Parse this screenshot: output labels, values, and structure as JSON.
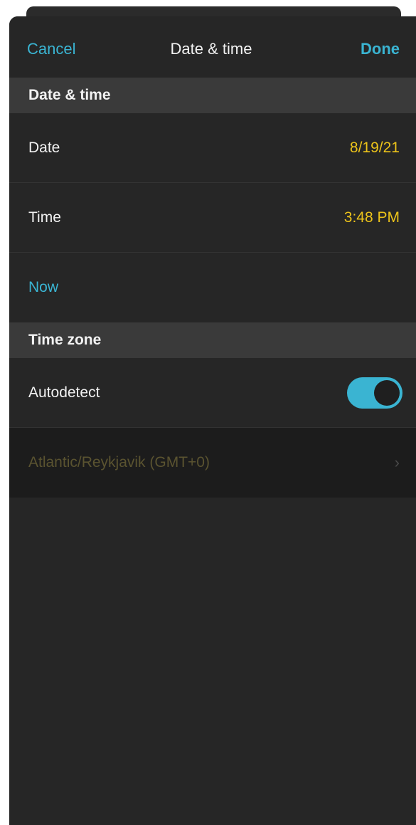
{
  "navbar": {
    "cancel_label": "Cancel",
    "title": "Date & time",
    "done_label": "Done"
  },
  "sections": {
    "datetime_header": "Date & time",
    "date_label": "Date",
    "date_value": "8/19/21",
    "time_label": "Time",
    "time_value": "3:48 PM",
    "now_label": "Now",
    "timezone_header": "Time zone",
    "autodetect_label": "Autodetect",
    "autodetect_on": true,
    "timezone_value": "Atlantic/Reykjavik (GMT+0)",
    "chevron_icon": "chevron-right-icon"
  },
  "colors": {
    "accent": "#3ab4d2",
    "value": "#ecc31a",
    "background": "#262626",
    "section": "#3a3a3a"
  }
}
